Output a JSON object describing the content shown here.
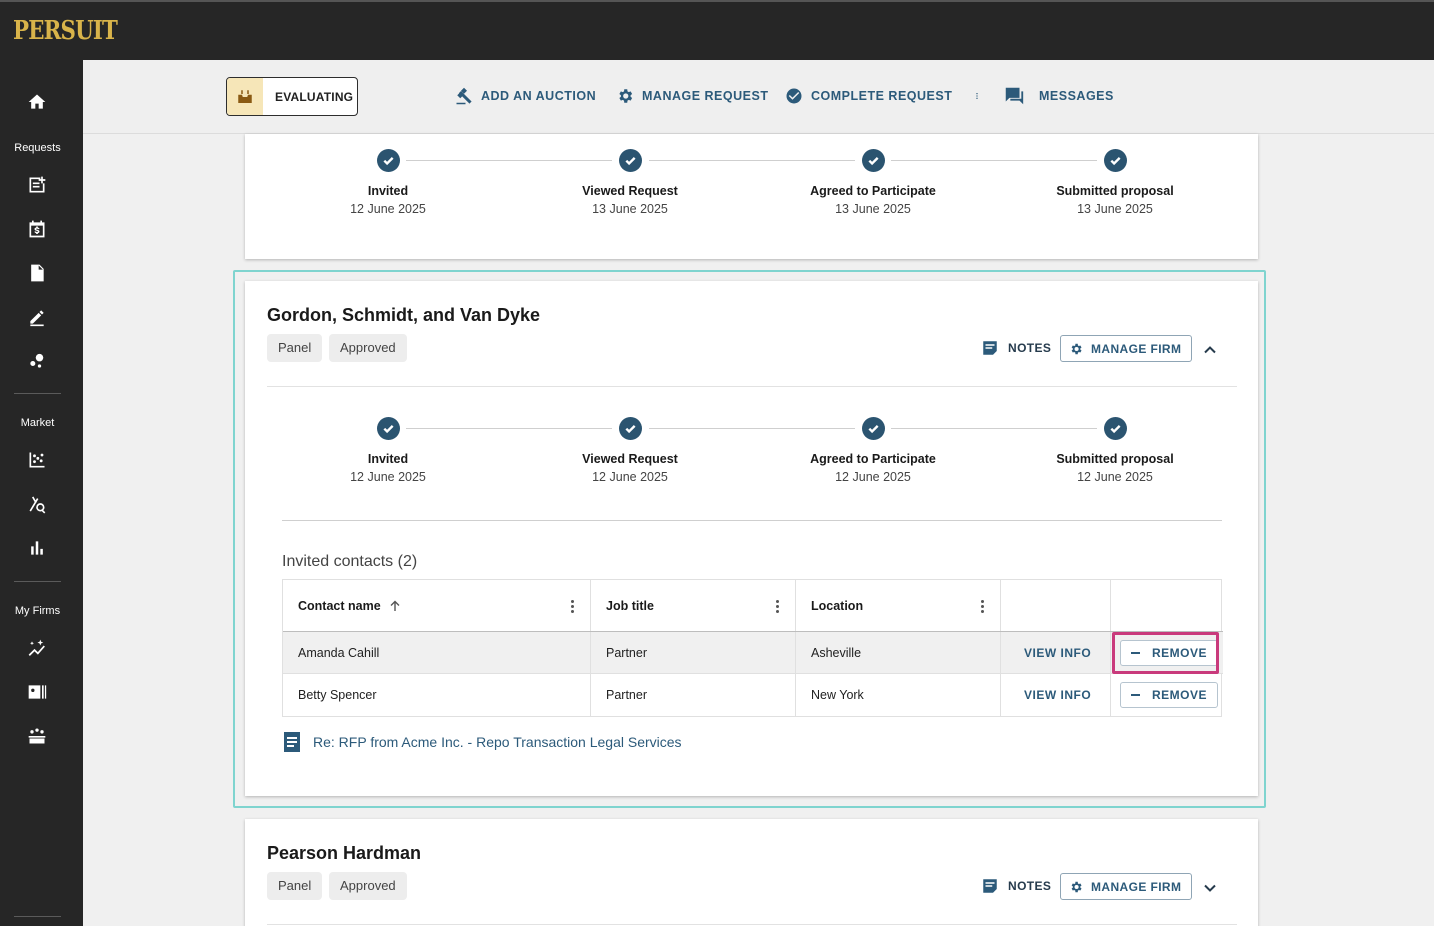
{
  "app": {
    "logo": "PERSUIT"
  },
  "sidenav": {
    "sections": [
      {
        "label": "Requests"
      },
      {
        "label": "Market"
      },
      {
        "label": "My Firms"
      }
    ],
    "icons": [
      "home-icon",
      "request-list-icon",
      "calendar-dollar-icon",
      "document-icon",
      "edit-icon",
      "bubbles-icon",
      "chart-scatter-icon",
      "analytics-search-icon",
      "bar-chart-icon",
      "trend-sparkle-icon",
      "contact-card-icon",
      "firm-group-icon"
    ]
  },
  "header": {
    "status": {
      "label": "EVALUATING",
      "icon": "inbox-icon"
    },
    "actions": [
      {
        "label": "ADD AN AUCTION",
        "icon": "gavel-icon"
      },
      {
        "label": "MANAGE REQUEST",
        "icon": "gear-icon"
      },
      {
        "label": "COMPLETE REQUEST",
        "icon": "check-circle-icon"
      },
      {
        "label": "MESSAGES",
        "icon": "chat-icon"
      }
    ]
  },
  "top_card": {
    "steps": [
      {
        "title": "Invited",
        "date": "12 June 2025"
      },
      {
        "title": "Viewed Request",
        "date": "13 June 2025"
      },
      {
        "title": "Agreed to Participate",
        "date": "13 June 2025"
      },
      {
        "title": "Submitted proposal",
        "date": "13 June 2025"
      }
    ]
  },
  "firm1": {
    "name": "Gordon, Schmidt, and Van Dyke",
    "chips": [
      "Panel",
      "Approved"
    ],
    "notes_label": "NOTES",
    "manage_label": "MANAGE FIRM",
    "steps": [
      {
        "title": "Invited",
        "date": "12 June 2025"
      },
      {
        "title": "Viewed Request",
        "date": "12 June 2025"
      },
      {
        "title": "Agreed to Participate",
        "date": "12 June 2025"
      },
      {
        "title": "Submitted proposal",
        "date": "12 June 2025"
      }
    ],
    "contacts_title": "Invited contacts (2)",
    "columns": [
      "Contact name",
      "Job title",
      "Location"
    ],
    "rows": [
      {
        "name": "Amanda Cahill",
        "job": "Partner",
        "location": "Asheville",
        "view": "VIEW INFO",
        "remove": "REMOVE"
      },
      {
        "name": "Betty Spencer",
        "job": "Partner",
        "location": "New York",
        "view": "VIEW INFO",
        "remove": "REMOVE"
      }
    ],
    "message_link": "Re: RFP from Acme Inc. - Repo Transaction Legal Services"
  },
  "firm2": {
    "name": "Pearson Hardman",
    "chips": [
      "Panel",
      "Approved"
    ],
    "notes_label": "NOTES",
    "manage_label": "MANAGE FIRM"
  }
}
